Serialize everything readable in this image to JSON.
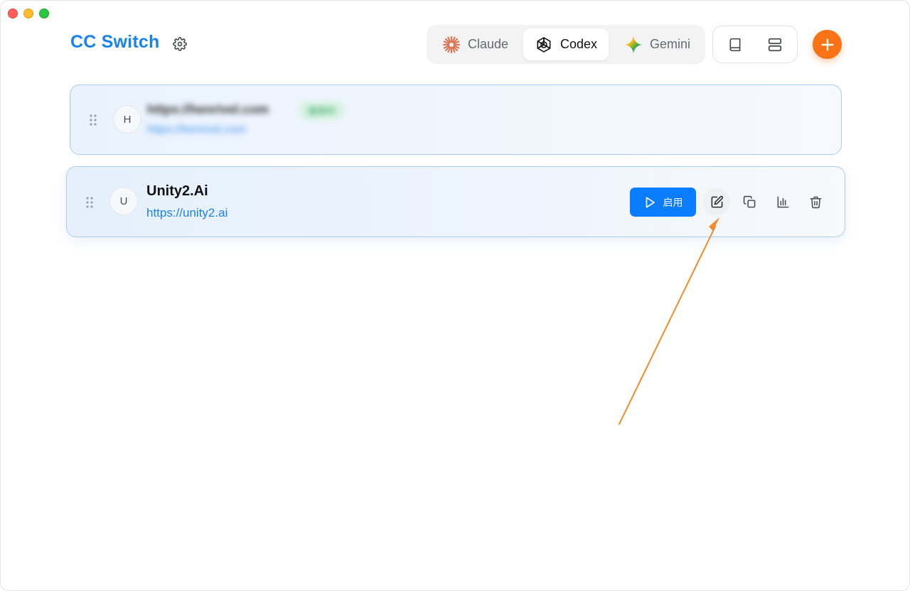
{
  "app": {
    "title": "CC Switch"
  },
  "tabs": [
    {
      "label": "Claude",
      "icon": "claude-icon",
      "active": false
    },
    {
      "label": "Codex",
      "icon": "openai-icon",
      "active": true
    },
    {
      "label": "Gemini",
      "icon": "gemini-icon",
      "active": false
    }
  ],
  "toolbar": {
    "view_icons": [
      "book-icon",
      "server-icon"
    ],
    "add_icon": "plus-icon"
  },
  "providers": [
    {
      "avatar": "H",
      "name": "https://henrivel.com",
      "badge": "使用中",
      "url": "https://henrivel.com",
      "blurred": true
    },
    {
      "avatar": "U",
      "name": "Unity2.Ai",
      "url": "https://unity2.ai",
      "enable_label": "启用",
      "blurred": false
    }
  ],
  "colors": {
    "brand": "#1a82f0",
    "primary_button": "#0a7cff",
    "add_button": "#f97316",
    "annotation_arrow": "#f58a2a"
  }
}
